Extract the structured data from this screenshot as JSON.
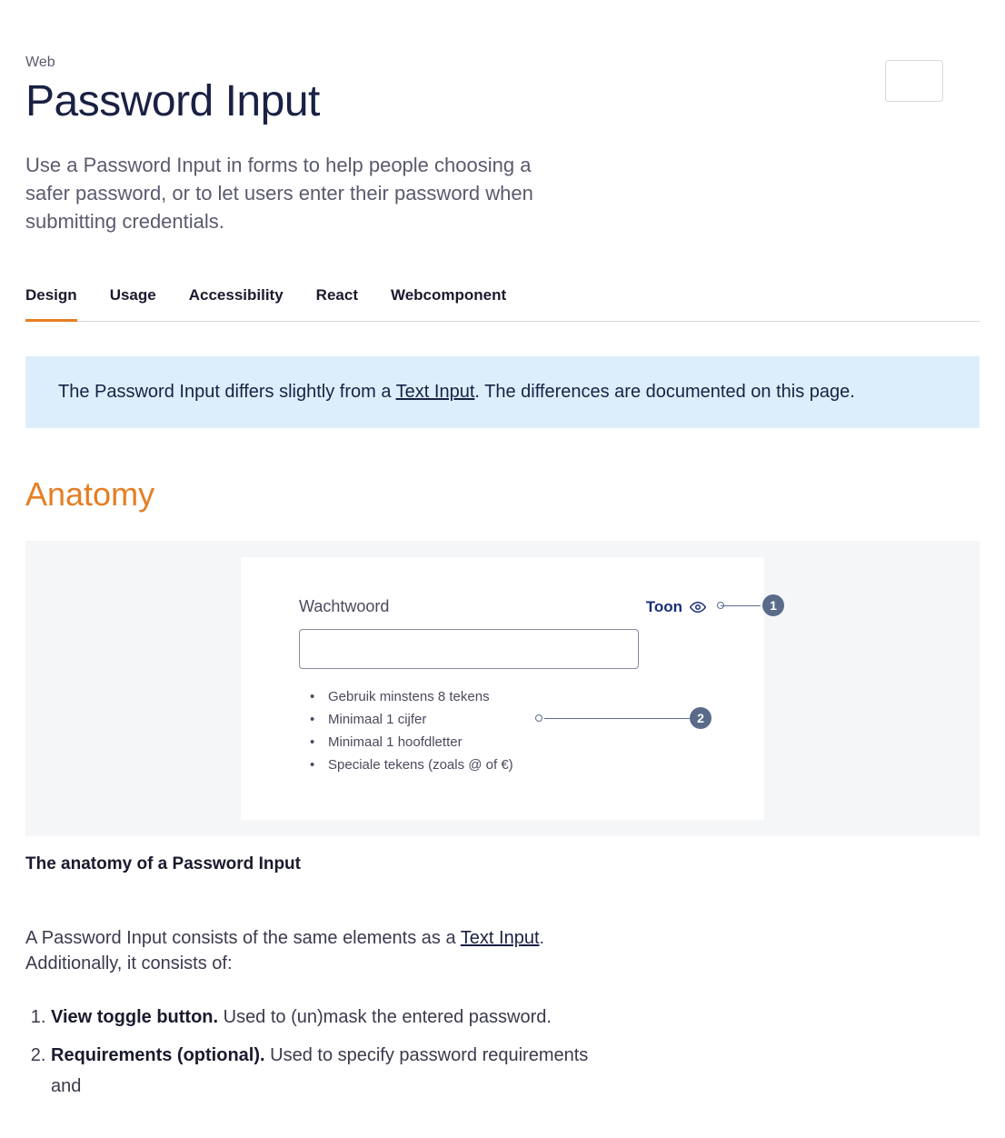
{
  "breadcrumb": "Web",
  "page_title": "Password Input",
  "page_description": "Use a Password Input in forms to help people choosing a safer password, or to let users enter their password when submitting credentials.",
  "toc_label": "toc-toggle",
  "tabs": [
    "Design",
    "Usage",
    "Accessibility",
    "React",
    "Webcomponent"
  ],
  "active_tab_index": 0,
  "notice": {
    "pre": "The Password Input differs slightly from a ",
    "link": "Text Input",
    "post": ". The differences are documented on this page."
  },
  "section_title": "Anatomy",
  "figure": {
    "label": "Wachtwoord",
    "toggle": "Toon",
    "requirements": [
      "Gebruik minstens 8 tekens",
      "Minimaal 1 cijfer",
      "Minimaal 1 hoofdletter",
      "Speciale tekens (zoals @ of €)"
    ],
    "annotation1": "1",
    "annotation2": "2"
  },
  "figure_caption": "The anatomy of a Password Input",
  "body_text": {
    "pre": "A Password Input consists of the same elements as a ",
    "link": "Text Input",
    "post": ". Additionally, it consists of:"
  },
  "elements": [
    {
      "strong": "View toggle button.",
      "rest": " Used to (un)mask the entered password."
    },
    {
      "strong": "Requirements (optional).",
      "rest": " Used to specify password requirements and"
    }
  ]
}
